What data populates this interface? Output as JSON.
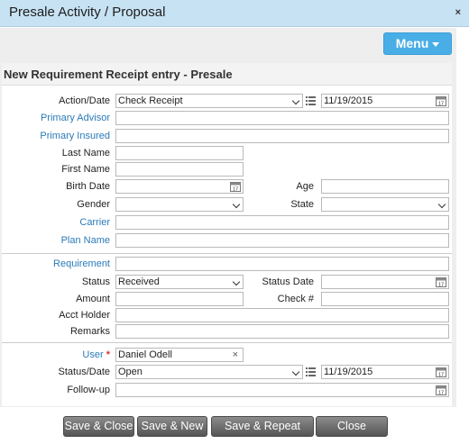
{
  "window": {
    "title": "Presale Activity / Proposal",
    "close_glyph": "×"
  },
  "menu": {
    "label": "Menu"
  },
  "section": {
    "title": "New Requirement Receipt entry - Presale"
  },
  "form": {
    "action_date_label": "Action/Date",
    "action_value": "Check Receipt",
    "action_date_value": "11/19/2015",
    "primary_advisor_label": "Primary Advisor",
    "primary_advisor_value": "",
    "primary_insured_label": "Primary Insured",
    "primary_insured_value": "",
    "last_name_label": "Last Name",
    "last_name_value": "",
    "first_name_label": "First Name",
    "first_name_value": "",
    "birth_date_label": "Birth Date",
    "birth_date_value": "",
    "age_label": "Age",
    "age_value": "",
    "gender_label": "Gender",
    "gender_value": "",
    "state_label": "State",
    "state_value": "",
    "carrier_label": "Carrier",
    "carrier_value": "",
    "plan_name_label": "Plan Name",
    "plan_name_value": "",
    "requirement_label": "Requirement",
    "requirement_value": "",
    "status_label": "Status",
    "status_value": "Received",
    "status_date_label": "Status Date",
    "status_date_value": "",
    "amount_label": "Amount",
    "amount_value": "",
    "check_no_label": "Check #",
    "check_no_value": "",
    "acct_holder_label": "Acct Holder",
    "acct_holder_value": "",
    "remarks_label": "Remarks",
    "remarks_value": "",
    "user_label": "User",
    "user_required_mark": "*",
    "user_value": "Daniel Odell",
    "user_clear_glyph": "×",
    "status_date2_label": "Status/Date",
    "status2_value": "Open",
    "status2_date_value": "11/19/2015",
    "followup_label": "Follow-up",
    "followup_value": ""
  },
  "buttons": {
    "save_close": "Save & Close",
    "save_new": "Save & New",
    "save_repeat": "Save & Repeat",
    "close": "Close"
  },
  "icons": {
    "calendar": "calendar-icon",
    "list": "list-icon",
    "dropdown": "chevron-down-icon",
    "close": "close-icon",
    "clear": "clear-icon"
  },
  "colors": {
    "titlebar": "#c7e2f3",
    "menu_button": "#4aaee6",
    "link_label": "#2a7ab8",
    "required": "#dd3333",
    "button_dark": "#555555"
  }
}
